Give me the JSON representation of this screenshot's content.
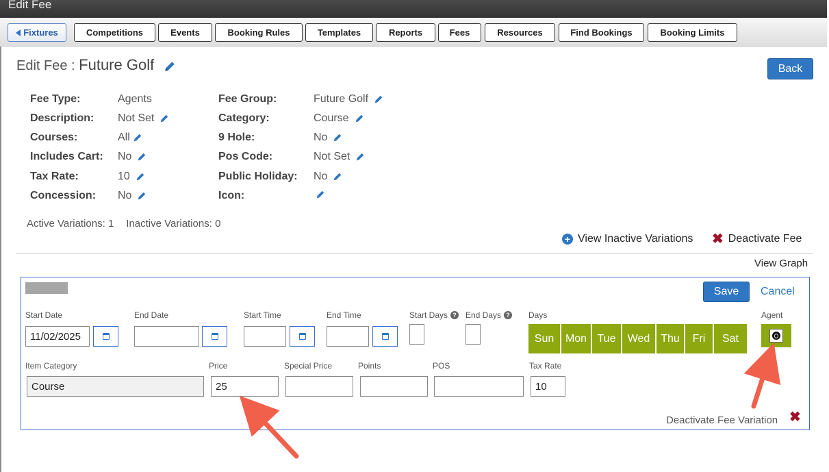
{
  "window": {
    "title": "Edit Fee"
  },
  "nav": {
    "items": [
      {
        "label": "Fixtures"
      },
      {
        "label": "Competitions"
      },
      {
        "label": "Events"
      },
      {
        "label": "Booking Rules"
      },
      {
        "label": "Templates"
      },
      {
        "label": "Reports"
      },
      {
        "label": "Fees"
      },
      {
        "label": "Resources"
      },
      {
        "label": "Find Bookings"
      },
      {
        "label": "Booking Limits"
      }
    ]
  },
  "header": {
    "prefix": "Edit Fee : ",
    "fee_name": "Future Golf",
    "back_label": "Back"
  },
  "details": {
    "left": [
      {
        "label": "Fee Type:",
        "value": "Agents"
      },
      {
        "label": "Description:",
        "value": "Not Set"
      },
      {
        "label": "Courses:",
        "value": "All"
      },
      {
        "label": "Includes Cart:",
        "value": "No"
      },
      {
        "label": "Tax Rate:",
        "value": "10"
      },
      {
        "label": "Concession:",
        "value": "No"
      }
    ],
    "right": [
      {
        "label": "Fee Group:",
        "value": "Future Golf"
      },
      {
        "label": "Category:",
        "value": "Course"
      },
      {
        "label": "9 Hole:",
        "value": "No"
      },
      {
        "label": "Pos Code:",
        "value": "Not Set"
      },
      {
        "label": "Public Holiday:",
        "value": "No"
      },
      {
        "label": "Icon:",
        "value": ""
      }
    ]
  },
  "counts": {
    "active": "Active Variations: 1",
    "inactive": "Inactive Variations: 0"
  },
  "actions": {
    "view_inactive": "View Inactive Variations",
    "deactivate_fee": "Deactivate Fee",
    "view_graph": "View Graph"
  },
  "variation": {
    "save_label": "Save",
    "cancel_label": "Cancel",
    "labels": {
      "start_date": "Start Date",
      "end_date": "End Date",
      "start_time": "Start Time",
      "end_time": "End Time",
      "start_days": "Start Days",
      "end_days": "End Days",
      "days": "Days",
      "agent": "Agent",
      "item_category": "Item Category",
      "price": "Price",
      "special_price": "Special Price",
      "points": "Points",
      "pos": "POS",
      "tax_rate": "Tax Rate"
    },
    "values": {
      "start_date": "11/02/2025",
      "end_date": "",
      "start_time": "",
      "end_time": "",
      "start_days": "",
      "end_days": "",
      "item_category": "Course",
      "price": "25",
      "special_price": "",
      "points": "",
      "pos": "",
      "tax_rate": "10"
    },
    "days": [
      "Sun",
      "Mon",
      "Tue",
      "Wed",
      "Thu",
      "Fri",
      "Sat"
    ],
    "deactivate_variation": "Deactivate Fee Variation"
  },
  "colors": {
    "accent": "#2f76c3",
    "day_green": "#8ea80f",
    "danger": "#a0122a",
    "arrow": "#f0604a"
  }
}
